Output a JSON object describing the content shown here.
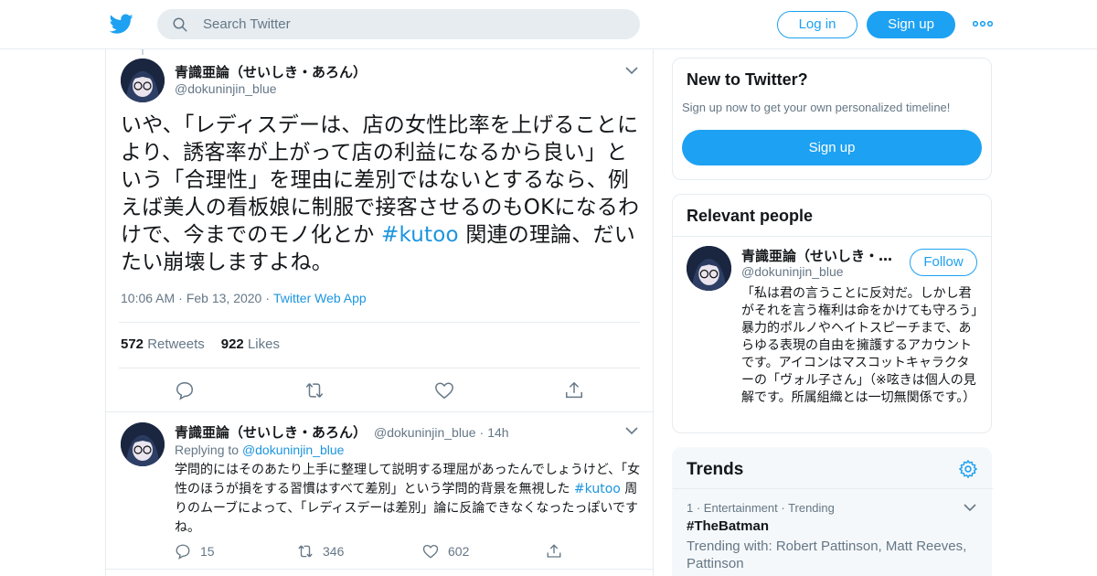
{
  "header": {
    "logo_icon": "twitter-bird-icon",
    "search_placeholder": "Search Twitter",
    "login_label": "Log in",
    "signup_label": "Sign up",
    "more_icon": "more-dots-icon",
    "accent_color": "#1da1f2"
  },
  "tweet": {
    "name": "青識亜論（せいしき・あろん）",
    "handle": "@dokuninjin_blue",
    "text_before": "いや、「レディスデーは、店の女性比率を上げることにより、誘客率が上がって店の利益になるから良い」という「合理性」を理由に差別ではないとするなら、例えば美人の看板娘に制服で接客させるのもOKになるわけで、今までのモノ化とか ",
    "hashtag": "#kutoo",
    "text_after": " 関連の理論、だいたい崩壊しますよね。",
    "time": "10:06 AM",
    "date": "Feb 13, 2020",
    "source": "Twitter Web App",
    "retweets": "572",
    "retweets_label": "Retweets",
    "likes": "922",
    "likes_label": "Likes"
  },
  "reply": {
    "name": "青識亜論（せいしき・あろん）",
    "handle": "@dokuninjin_blue",
    "age": "14h",
    "replying_label": "Replying to",
    "replying_to": "@dokuninjin_blue",
    "text_before": "学問的にはそのあたり上手に整理して説明する理屈があったんでしょうけど、「女性のほうが損をする習慣はすべて差別」という学問的背景を無視した ",
    "hashtag": "#kutoo",
    "text_after": " 周りのムーブによって、「レディスデーは差別」論に反論できなくなったっぽいですね。",
    "replies": "15",
    "retweets": "346",
    "likes": "602"
  },
  "sidebar": {
    "new": {
      "title": "New to Twitter?",
      "subtitle": "Sign up now to get your own personalized timeline!",
      "button": "Sign up"
    },
    "relevant": {
      "title": "Relevant people",
      "name": "青識亜論（せいしき・…",
      "handle": "@dokuninjin_blue",
      "follow": "Follow",
      "bio": "「私は君の言うことに反対だ。しかし君がそれを言う権利は命をかけても守ろう」暴力的ポルノやヘイトスピーチまで、あらゆる表現の自由を擁護するアカウントです。アイコンはマスコットキャラクターの「ヴォル子さん」（※呟きは個人の見解です。所属組織とは一切無関係です。）"
    },
    "trends": {
      "title": "Trends",
      "rank": "1",
      "category": "Entertainment",
      "status": "Trending",
      "name": "#TheBatman",
      "with": "Trending with: Robert Pattinson, Matt Reeves, Pattinson"
    }
  }
}
